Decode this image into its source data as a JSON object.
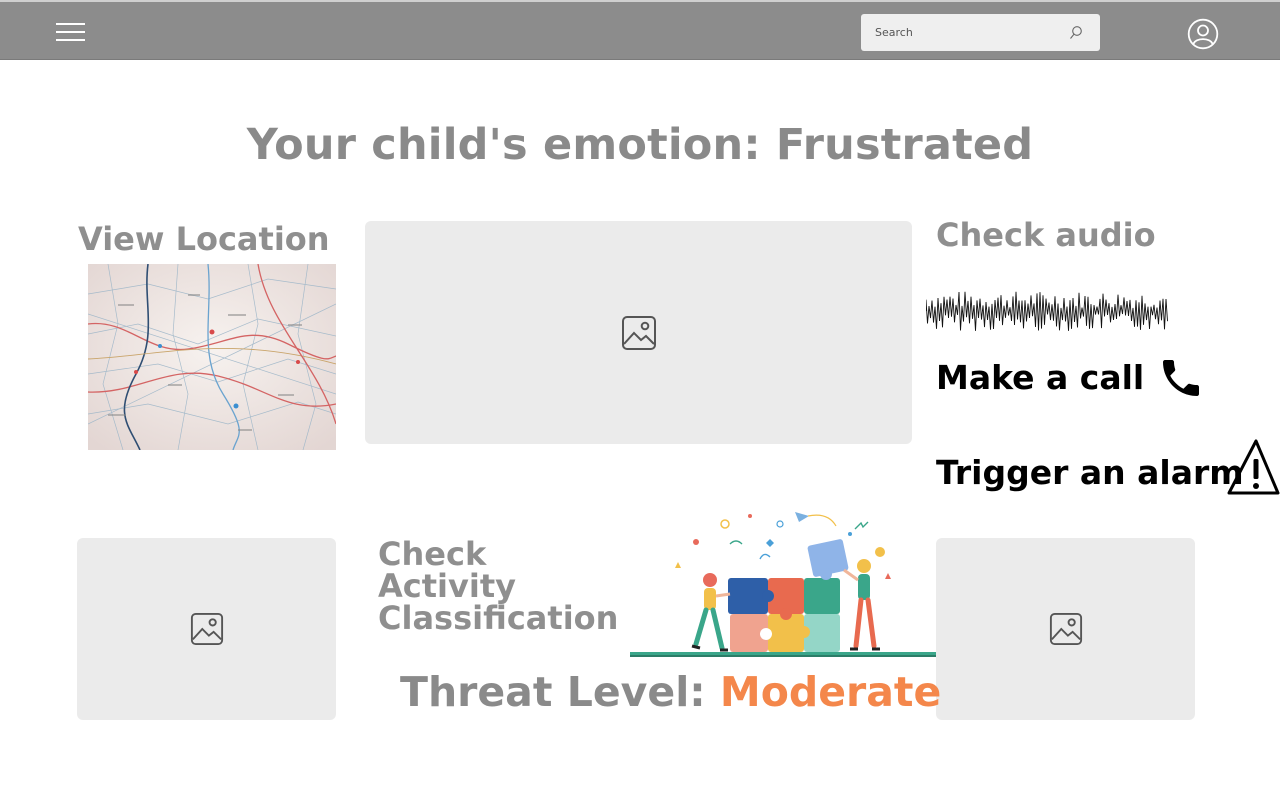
{
  "header": {
    "search": {
      "placeholder": "Search",
      "value": ""
    }
  },
  "main": {
    "title": "Your child's emotion: Frustrated",
    "location": {
      "label": "View Location"
    },
    "audio": {
      "label": "Check audio"
    },
    "call": {
      "label": "Make a call"
    },
    "alarm": {
      "label": "Trigger an alarm"
    },
    "activity": {
      "label_lines": [
        "Check",
        "Activity",
        "Classification"
      ]
    },
    "threat": {
      "label": "Threat Level:",
      "value": "Moderate",
      "value_color": "#f4874b"
    }
  },
  "icons": [
    "menu-icon",
    "search-icon",
    "user-account-icon",
    "image-placeholder-icon",
    "phone-icon",
    "warning-icon"
  ],
  "colors": {
    "topbar": "#8c8c8c",
    "heading_gray": "#8a8a8a",
    "threat_orange": "#f4874b",
    "placeholder_bg": "#ebebeb"
  }
}
